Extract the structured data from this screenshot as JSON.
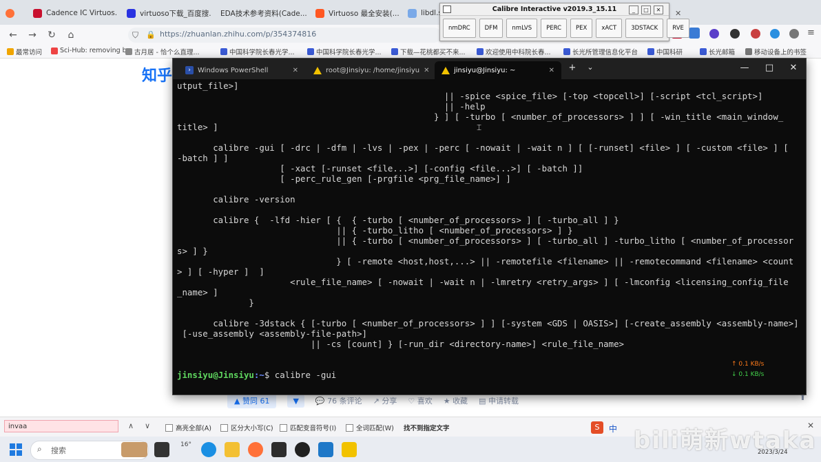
{
  "browser": {
    "tabs": [
      {
        "title": "Cadence IC Virtuos...",
        "color": "#c8102e"
      },
      {
        "title": "virtuoso下载_百度搜...",
        "color": "#2932e1"
      },
      {
        "title": "EDA技术参考资料(Cade...",
        "color": "#7aa9e8"
      },
      {
        "title": "Virtuoso 最全安装(...",
        "color": "#ff5722"
      },
      {
        "title": "libdl.so",
        "color": "#7aa9e8"
      }
    ],
    "url": "https://zhuanlan.zhihu.com/p/354374816",
    "bookmarks": [
      "最常访问",
      "Sci-Hub: removing b...",
      "古月居 - 恰个么直理...",
      "中国科学院长春光学...",
      "中国科学院长春光学...",
      "下载—花桃都买不来...",
      "欢迎使用中科院长春...",
      "长光所管理信息化平台",
      "中国科研",
      "长光邮箱",
      "移动设备上的书签"
    ]
  },
  "zhihu": {
    "logo": "知乎",
    "vote_label": "▲ 赞同 61",
    "vote_down": "▼",
    "comments": "76 条评论",
    "share": "分享",
    "like": "喜欢",
    "favorite": "收藏",
    "apply_reprint": "申请转载"
  },
  "calibre": {
    "title": "Calibre Interactive v2019.3_15.11",
    "tools": [
      "nmDRC",
      "DFM",
      "nmLVS",
      "PERC",
      "PEX",
      "xACT",
      "3DSTACK",
      "RVE"
    ]
  },
  "terminal": {
    "tabs": [
      {
        "title": "Windows PowerShell"
      },
      {
        "title": "root@Jinsiyu: /home/jinsiyu"
      },
      {
        "title": "jinsiyu@Jinsiyu: ~"
      }
    ],
    "new_tab": "+",
    "dropdown": "⌄",
    "lines": [
      "utput_file>]",
      "                                                    || -spice <spice_file> [-top <topcell>] [-script <tcl_script>]",
      "                                                    || -help",
      "                                                  } ] [ -turbo [ <number_of_processors> ] ] [ -win_title <main_window_",
      "title> ]",
      "",
      "       calibre -gui [ -drc | -dfm | -lvs | -pex | -perc [ -nowait | -wait n ] [ [-runset] <file> ] [ -custom <file> ] [",
      "-batch ] ]",
      "                    [ -xact [-runset <file...>] [-config <file...>] [ -batch ]]",
      "                    [ -perc_rule_gen [-prgfile <prg_file_name>] ]",
      "",
      "       calibre -version",
      "",
      "       calibre {  -lfd -hier [ {  { -turbo [ <number_of_processors> ] [ -turbo_all ] }",
      "                               || { -turbo_litho [ <number_of_processors> ] }",
      "                               || { -turbo [ <number_of_processors> ] [ -turbo_all ] -turbo_litho [ <number_of_processor",
      "s> ] }",
      "                               } [ -remote <host,host,...> || -remotefile <filename> || -remotecommand <filename> <count",
      "> ] [ -hyper ]  ]",
      "                      <rule_file_name> [ -nowait | -wait n | -lmretry <retry_args> ] [ -lmconfig <licensing_config_file",
      "_name> ]",
      "              }",
      "",
      "       calibre -3dstack { [-turbo [ <number_of_processors> ] ] [-system <GDS | OASIS>] [-create_assembly <assembly-name>]",
      " [-use_assembly <assembly-file-path>]",
      "                          || -cs [count] } [-run_dir <directory-name>] <rule_file_name>",
      "",
      ""
    ],
    "prompt_user": "jinsiyu@Jinsiyu",
    "prompt_path": ":~",
    "prompt_symbol": "$ ",
    "command": "calibre -gui",
    "net_up": "↑ 0.1 KB/s",
    "net_down": "↓ 0.1 KB/s"
  },
  "findbar": {
    "query": "invaa",
    "options": [
      "高亮全部(A)",
      "区分大小写(C)",
      "匹配变音符号(I)",
      "全词匹配(W)"
    ],
    "status": "找不到指定文字"
  },
  "taskbar": {
    "search_placeholder": "搜索",
    "weather": "16°",
    "ime": "中",
    "date": "2023/3/24",
    "watermark": "bili萌新wtaka"
  }
}
